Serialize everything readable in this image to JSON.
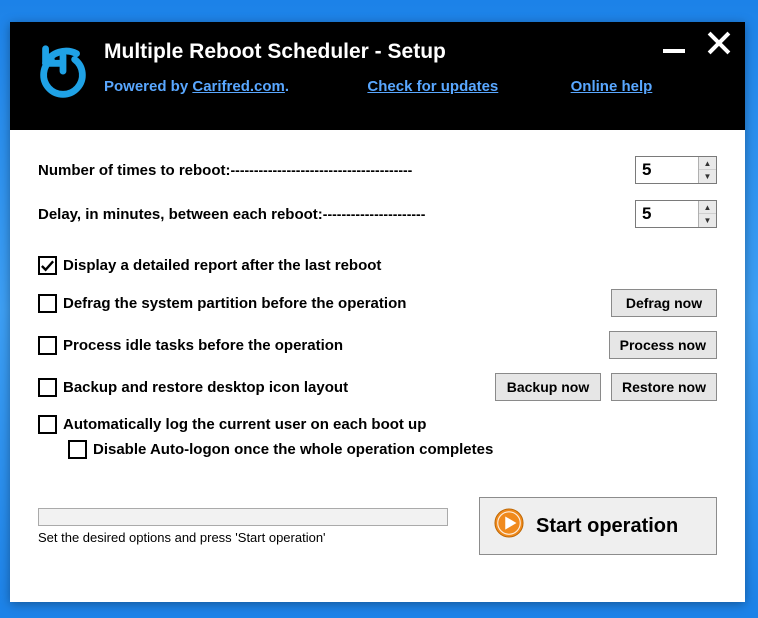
{
  "header": {
    "title": "Multiple Reboot Scheduler - Setup",
    "powered_prefix": "Powered by ",
    "powered_link": "Carifred.com",
    "powered_suffix": ".",
    "updates_link": "Check for updates",
    "help_link": "Online help"
  },
  "fields": {
    "reboot_count_label": "Number of times to reboot:",
    "reboot_count_dashes": "---------------------------------------",
    "reboot_count_value": "5",
    "delay_label": "Delay, in minutes, between each reboot:",
    "delay_dashes": "----------------------",
    "delay_value": "5"
  },
  "options": {
    "detailed_report": {
      "label": "Display a detailed report after the last reboot",
      "checked": true
    },
    "defrag": {
      "label": "Defrag the system partition before the operation",
      "checked": false,
      "btn": "Defrag now"
    },
    "idle_tasks": {
      "label": "Process idle tasks before the operation",
      "checked": false,
      "btn": "Process now"
    },
    "icon_layout": {
      "label": "Backup and restore desktop icon layout",
      "checked": false,
      "backup_btn": "Backup now",
      "restore_btn": "Restore now"
    },
    "auto_logon": {
      "label": "Automatically log the current user on each boot up",
      "checked": false
    },
    "disable_auto_logon": {
      "label": "Disable Auto-logon once the whole operation completes",
      "checked": false
    }
  },
  "footer": {
    "status": "Set the desired options and press 'Start operation'",
    "start_label": "Start operation"
  }
}
